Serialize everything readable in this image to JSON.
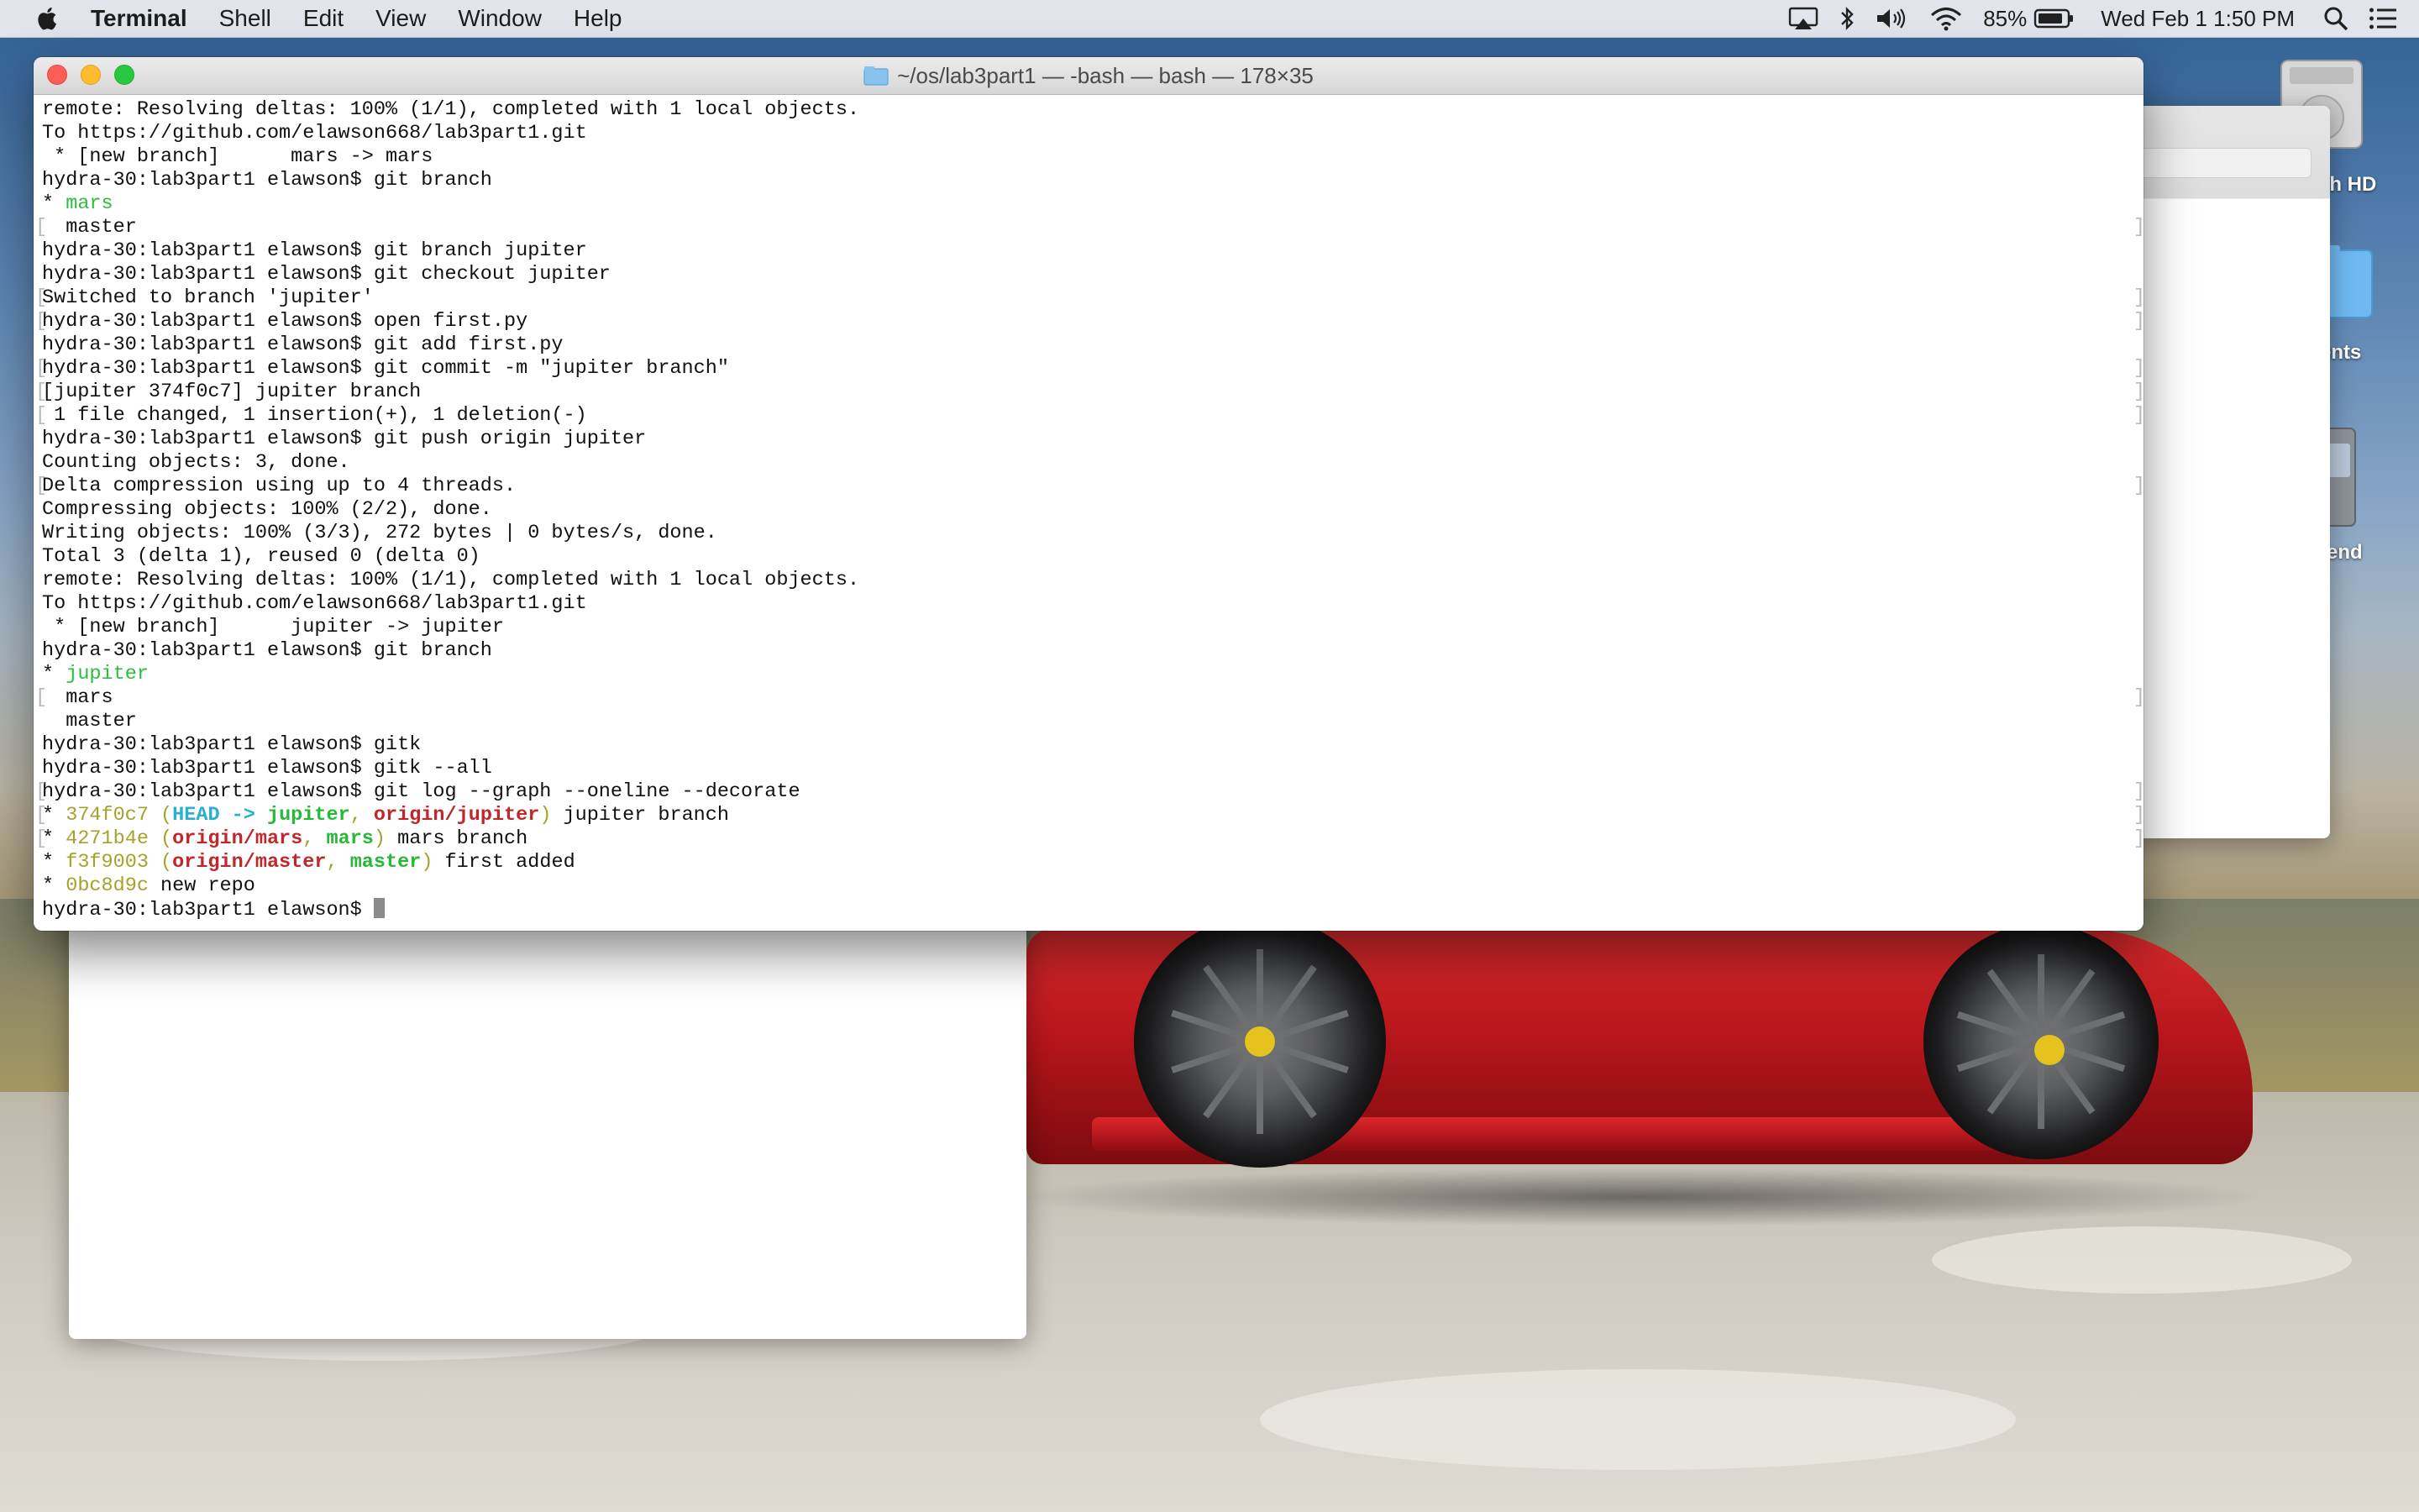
{
  "menubar": {
    "app_name": "Terminal",
    "menus": [
      "Shell",
      "Edit",
      "View",
      "Window",
      "Help"
    ],
    "battery": "85%",
    "clock": "Wed Feb 1  1:50 PM"
  },
  "desktop": {
    "icons": [
      {
        "label": "sh HD",
        "icon": "hard-drive-icon"
      },
      {
        "label": "ents",
        "icon": "folder-icon"
      },
      {
        "label": "end",
        "icon": "document-icon"
      }
    ]
  },
  "terminal": {
    "title": "~/os/lab3part1 — -bash — bash — 178×35",
    "lines": [
      {
        "segments": [
          {
            "t": "remote: Resolving deltas: 100% (1/1), completed with 1 local objects."
          }
        ]
      },
      {
        "segments": [
          {
            "t": "To https://github.com/elawson668/lab3part1.git"
          }
        ]
      },
      {
        "segments": [
          {
            "t": " * [new branch]      mars -> mars"
          }
        ]
      },
      {
        "segments": [
          {
            "t": "hydra-30:lab3part1 elawson$ git branch"
          }
        ]
      },
      {
        "segments": [
          {
            "t": "* "
          },
          {
            "t": "mars",
            "c": "c-green"
          }
        ]
      },
      {
        "mark": true,
        "segments": [
          {
            "t": "  master"
          }
        ]
      },
      {
        "segments": [
          {
            "t": "hydra-30:lab3part1 elawson$ git branch jupiter"
          }
        ]
      },
      {
        "segments": [
          {
            "t": "hydra-30:lab3part1 elawson$ git checkout jupiter"
          }
        ]
      },
      {
        "mark": true,
        "segments": [
          {
            "t": "Switched to branch 'jupiter'"
          }
        ]
      },
      {
        "mark": true,
        "segments": [
          {
            "t": "hydra-30:lab3part1 elawson$ open first.py"
          }
        ]
      },
      {
        "segments": [
          {
            "t": "hydra-30:lab3part1 elawson$ git add first.py"
          }
        ]
      },
      {
        "mark": true,
        "segments": [
          {
            "t": "hydra-30:lab3part1 elawson$ git commit -m \"jupiter branch\""
          }
        ]
      },
      {
        "mark": true,
        "segments": [
          {
            "t": "[jupiter 374f0c7] jupiter branch"
          }
        ]
      },
      {
        "mark": true,
        "segments": [
          {
            "t": " 1 file changed, 1 insertion(+), 1 deletion(-)"
          }
        ]
      },
      {
        "segments": [
          {
            "t": "hydra-30:lab3part1 elawson$ git push origin jupiter"
          }
        ]
      },
      {
        "segments": [
          {
            "t": "Counting objects: 3, done."
          }
        ]
      },
      {
        "mark": true,
        "segments": [
          {
            "t": "Delta compression using up to 4 threads."
          }
        ]
      },
      {
        "segments": [
          {
            "t": "Compressing objects: 100% (2/2), done."
          }
        ]
      },
      {
        "segments": [
          {
            "t": "Writing objects: 100% (3/3), 272 bytes | 0 bytes/s, done."
          }
        ]
      },
      {
        "segments": [
          {
            "t": "Total 3 (delta 1), reused 0 (delta 0)"
          }
        ]
      },
      {
        "segments": [
          {
            "t": "remote: Resolving deltas: 100% (1/1), completed with 1 local objects."
          }
        ]
      },
      {
        "segments": [
          {
            "t": "To https://github.com/elawson668/lab3part1.git"
          }
        ]
      },
      {
        "segments": [
          {
            "t": " * [new branch]      jupiter -> jupiter"
          }
        ]
      },
      {
        "segments": [
          {
            "t": "hydra-30:lab3part1 elawson$ git branch"
          }
        ]
      },
      {
        "segments": [
          {
            "t": "* "
          },
          {
            "t": "jupiter",
            "c": "c-green"
          }
        ]
      },
      {
        "mark": true,
        "segments": [
          {
            "t": "  mars"
          }
        ]
      },
      {
        "segments": [
          {
            "t": "  master"
          }
        ]
      },
      {
        "segments": [
          {
            "t": "hydra-30:lab3part1 elawson$ gitk"
          }
        ]
      },
      {
        "segments": [
          {
            "t": "hydra-30:lab3part1 elawson$ gitk --all"
          }
        ]
      },
      {
        "mark": true,
        "segments": [
          {
            "t": "hydra-30:lab3part1 elawson$ git log --graph --oneline --decorate"
          }
        ]
      },
      {
        "mark": true,
        "segments": [
          {
            "t": "* "
          },
          {
            "t": "374f0c7 (",
            "c": "c-yellow"
          },
          {
            "t": "HEAD -> ",
            "c": "c-cyan"
          },
          {
            "t": "jupiter",
            "c": "c-grn-b"
          },
          {
            "t": ", ",
            "c": "c-yellow"
          },
          {
            "t": "origin/jupiter",
            "c": "c-red"
          },
          {
            "t": ")",
            "c": "c-yellow"
          },
          {
            "t": " jupiter branch"
          }
        ]
      },
      {
        "mark": true,
        "segments": [
          {
            "t": "* "
          },
          {
            "t": "4271b4e (",
            "c": "c-yellow"
          },
          {
            "t": "origin/mars",
            "c": "c-red"
          },
          {
            "t": ", ",
            "c": "c-yellow"
          },
          {
            "t": "mars",
            "c": "c-grn-b"
          },
          {
            "t": ")",
            "c": "c-yellow"
          },
          {
            "t": " mars branch"
          }
        ]
      },
      {
        "segments": [
          {
            "t": "* "
          },
          {
            "t": "f3f9003 (",
            "c": "c-yellow"
          },
          {
            "t": "origin/master",
            "c": "c-red"
          },
          {
            "t": ", ",
            "c": "c-yellow"
          },
          {
            "t": "master",
            "c": "c-grn-b"
          },
          {
            "t": ")",
            "c": "c-yellow"
          },
          {
            "t": " first added"
          }
        ]
      },
      {
        "segments": [
          {
            "t": "* "
          },
          {
            "t": "0bc8d9c",
            "c": "c-yellow"
          },
          {
            "t": " new repo"
          }
        ]
      },
      {
        "prompt": true,
        "segments": [
          {
            "t": "hydra-30:lab3part1 elawson$ "
          }
        ]
      }
    ]
  }
}
